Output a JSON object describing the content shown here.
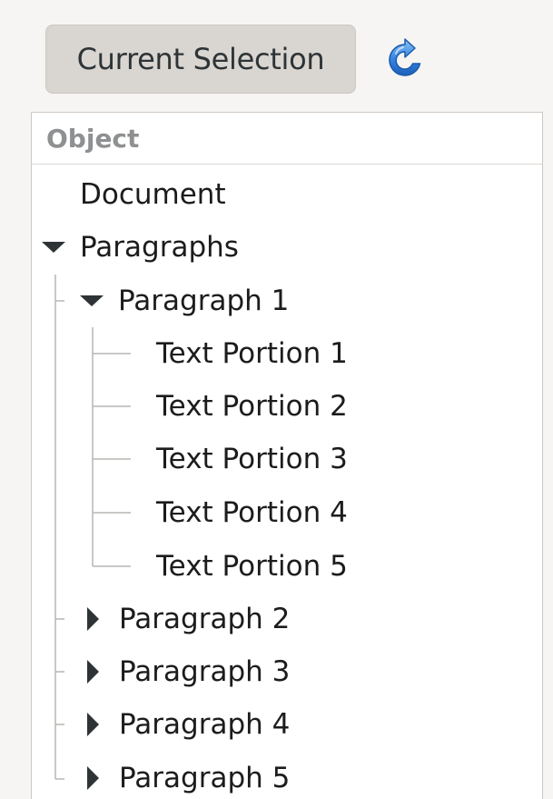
{
  "toolbar": {
    "current_selection_label": "Current Selection",
    "refresh_icon": "refresh-icon",
    "refresh_color": "#3584e4"
  },
  "tree": {
    "column_header": "Object",
    "rows": [
      {
        "label": "Document",
        "expander": "none"
      },
      {
        "label": "Paragraphs",
        "expander": "expanded"
      },
      {
        "label": "Paragraph 1",
        "expander": "expanded"
      },
      {
        "label": "Text Portion 1",
        "expander": "none"
      },
      {
        "label": "Text Portion 2",
        "expander": "none"
      },
      {
        "label": "Text Portion 3",
        "expander": "none"
      },
      {
        "label": "Text Portion 4",
        "expander": "none"
      },
      {
        "label": "Text Portion 5",
        "expander": "none"
      },
      {
        "label": "Paragraph 2",
        "expander": "collapsed"
      },
      {
        "label": "Paragraph 3",
        "expander": "collapsed"
      },
      {
        "label": "Paragraph 4",
        "expander": "collapsed"
      },
      {
        "label": "Paragraph 5",
        "expander": "collapsed"
      }
    ]
  }
}
